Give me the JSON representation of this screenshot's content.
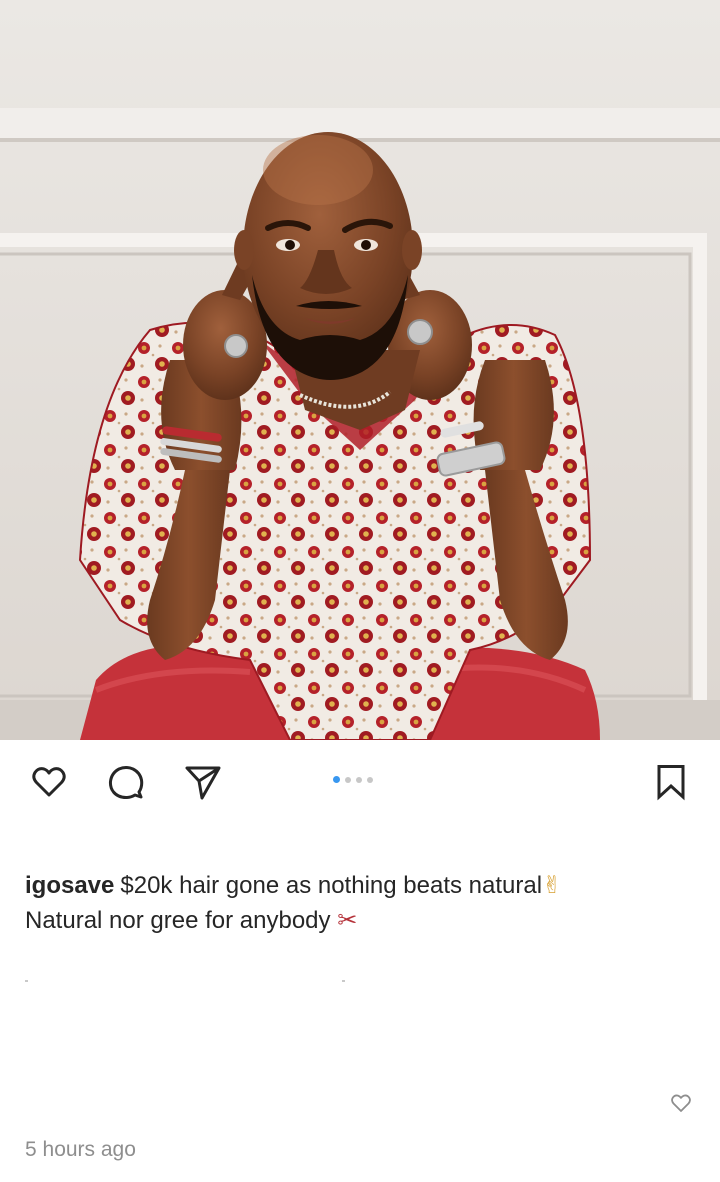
{
  "post": {
    "username": "igosave",
    "caption_line1": "$20k hair gone as nothing beats natural",
    "caption_emoji1": "✌",
    "caption_line2": "Natural nor gree for anybody",
    "caption_emoji2": "✂",
    "timestamp": "5 hours ago",
    "carousel": {
      "total": 4,
      "active": 1
    }
  },
  "icons": {
    "like": "heart-icon",
    "comment": "comment-icon",
    "share": "paper-plane-icon",
    "save": "bookmark-icon",
    "caption_like": "small-heart-icon"
  },
  "colors": {
    "accent": "#3897f0",
    "text": "#262626",
    "muted": "#8e8e8e"
  }
}
